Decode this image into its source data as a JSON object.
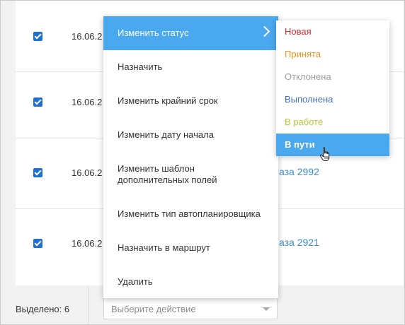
{
  "rows": [
    {
      "date": "16.06.2",
      "link": ""
    },
    {
      "date": "16.06.2",
      "link": ""
    },
    {
      "date": "16.06.2",
      "link": "аза 2992"
    },
    {
      "date": "16.06.2",
      "link": "аза 2921"
    }
  ],
  "footer": {
    "selected_label": "Выделено: 6",
    "action_placeholder": "Выберите действие"
  },
  "menu": {
    "items": [
      "Изменить статус",
      "Назначить",
      "Изменить крайний срок",
      "Изменить дату начала",
      "Изменить шаблон дополнительных полей",
      "Изменить тип автопланировщика",
      "Назначить в маршрут",
      "Удалить"
    ]
  },
  "submenu": {
    "items": [
      {
        "label": "Новая",
        "color": "#d9262c"
      },
      {
        "label": "Принята",
        "color": "#f0931e"
      },
      {
        "label": "Отклонена",
        "color": "#9e9e9e"
      },
      {
        "label": "Выполнена",
        "color": "#3f6fc4"
      },
      {
        "label": "В работе",
        "color": "#b5c934"
      },
      {
        "label": "В пути",
        "color": "#ffffff"
      }
    ]
  },
  "colors": {
    "accent": "#4aa8ee",
    "checkbox": "#1f6fd1",
    "link": "#3b8fd1"
  },
  "icons": {
    "submenu_arrow": "chevron-right-icon",
    "pointer": "hand-pointer-icon",
    "select_caret": "caret-down-icon"
  }
}
